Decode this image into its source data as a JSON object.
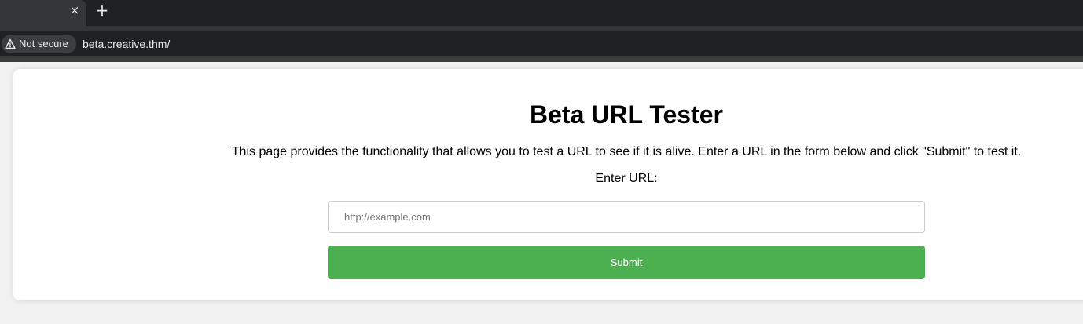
{
  "browser": {
    "tab": {
      "close_glyph": "×"
    },
    "new_tab_glyph": "+",
    "security_label": "Not secure",
    "url": "beta.creative.thm/"
  },
  "page": {
    "title": "Beta URL Tester",
    "description": "This page provides the functionality that allows you to test a URL to see if it is alive. Enter a URL in the form below and click \"Submit\" to test it.",
    "url_label": "Enter URL:",
    "url_input": {
      "value": "",
      "placeholder": "http://example.com"
    },
    "submit_label": "Submit"
  },
  "colors": {
    "accent": "#4caf50",
    "browser_frame": "#202124",
    "page_background": "#f2f2f2"
  },
  "icons": {
    "security": "warning-triangle-icon",
    "close": "close-icon",
    "new_tab": "plus-icon"
  }
}
